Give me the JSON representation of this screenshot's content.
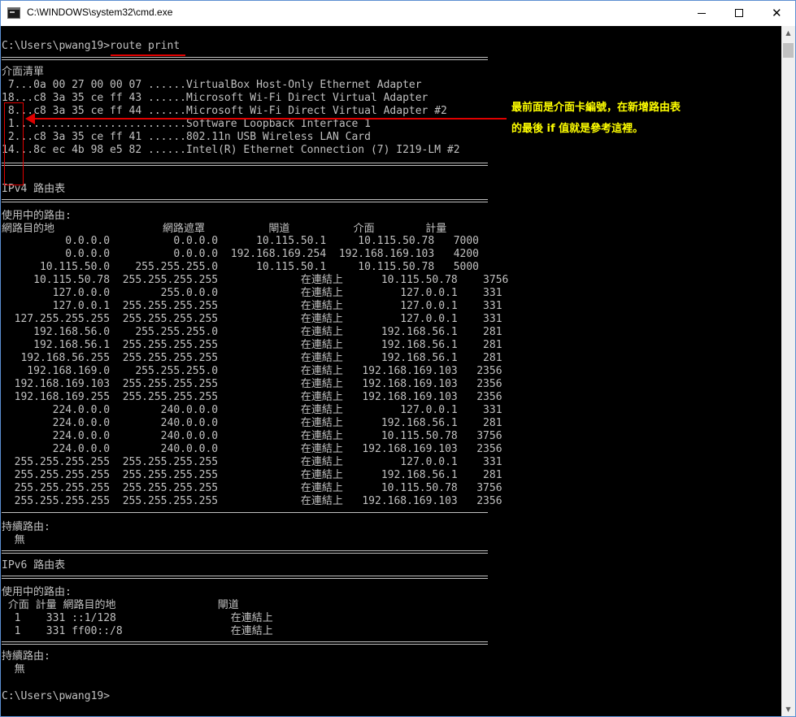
{
  "window": {
    "title": "C:\\WINDOWS\\system32\\cmd.exe",
    "minimize_glyph": "",
    "maximize_glyph": "",
    "close_glyph": "✕"
  },
  "console": {
    "prompt_line": "C:\\Users\\pwang19>route print",
    "interface_list_header": "介面清單",
    "interfaces": [
      " 7...0a 00 27 00 00 07 ......VirtualBox Host-Only Ethernet Adapter",
      "18...c8 3a 35 ce ff 43 ......Microsoft Wi-Fi Direct Virtual Adapter",
      " 8...c8 3a 35 ce ff 44 ......Microsoft Wi-Fi Direct Virtual Adapter #2",
      " 1...........................Software Loopback Interface 1",
      " 2...c8 3a 35 ce ff 41 ......802.11n USB Wireless LAN Card",
      "14...8c ec 4b 98 e5 82 ......Intel(R) Ethernet Connection (7) I219-LM #2"
    ],
    "ipv4_header": "IPv4 路由表",
    "active_routes_label": "使用中的路由:",
    "ipv4_columns": "網路目的地                 網路遮罩          閘道          介面        計量",
    "ipv4_routes": [
      "          0.0.0.0          0.0.0.0      10.115.50.1     10.115.50.78   7000",
      "          0.0.0.0          0.0.0.0  192.168.169.254  192.168.169.103   4200",
      "      10.115.50.0    255.255.255.0      10.115.50.1     10.115.50.78   5000",
      "     10.115.50.78  255.255.255.255             在連結上      10.115.50.78    3756",
      "        127.0.0.0        255.0.0.0             在連結上         127.0.0.1    331",
      "        127.0.0.1  255.255.255.255             在連結上         127.0.0.1    331",
      "  127.255.255.255  255.255.255.255             在連結上         127.0.0.1    331",
      "     192.168.56.0    255.255.255.0             在連結上      192.168.56.1    281",
      "     192.168.56.1  255.255.255.255             在連結上      192.168.56.1    281",
      "   192.168.56.255  255.255.255.255             在連結上      192.168.56.1    281",
      "    192.168.169.0    255.255.255.0             在連結上   192.168.169.103   2356",
      "  192.168.169.103  255.255.255.255             在連結上   192.168.169.103   2356",
      "  192.168.169.255  255.255.255.255             在連結上   192.168.169.103   2356",
      "        224.0.0.0        240.0.0.0             在連結上         127.0.0.1    331",
      "        224.0.0.0        240.0.0.0             在連結上      192.168.56.1    281",
      "        224.0.0.0        240.0.0.0             在連結上      10.115.50.78   3756",
      "        224.0.0.0        240.0.0.0             在連結上   192.168.169.103   2356",
      "  255.255.255.255  255.255.255.255             在連結上         127.0.0.1    331",
      "  255.255.255.255  255.255.255.255             在連結上      192.168.56.1    281",
      "  255.255.255.255  255.255.255.255             在連結上      10.115.50.78   3756",
      "  255.255.255.255  255.255.255.255             在連結上   192.168.169.103   2356"
    ],
    "persistent_routes_label": "持續路由:",
    "none_value": "  無",
    "ipv6_header": "IPv6 路由表",
    "ipv6_columns": " 介面 計量 網路目的地                閘道",
    "ipv6_routes": [
      "  1    331 ::1/128                  在連結上",
      "  1    331 ff00::/8                 在連結上"
    ],
    "final_prompt": "C:\\Users\\pwang19>"
  },
  "annotation": {
    "line1": "最前面是介面卡編號，在新增路由表",
    "line2": "的最後 if 值就是參考這裡。",
    "color": "#ffff00",
    "highlight_color": "#e00000"
  }
}
